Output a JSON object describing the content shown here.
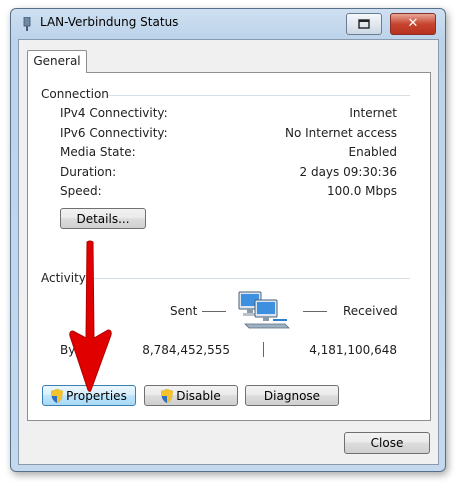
{
  "window": {
    "title": "LAN-Verbindung Status"
  },
  "tabs": [
    {
      "label": "General",
      "active": true
    }
  ],
  "connection": {
    "label": "Connection",
    "rows": [
      {
        "label": "IPv4 Connectivity:",
        "value": "Internet"
      },
      {
        "label": "IPv6 Connectivity:",
        "value": "No Internet access"
      },
      {
        "label": "Media State:",
        "value": "Enabled"
      },
      {
        "label": "Duration:",
        "value": "2 days 09:30:36"
      },
      {
        "label": "Speed:",
        "value": "100.0 Mbps"
      }
    ],
    "details_button": "Details..."
  },
  "activity": {
    "label": "Activity",
    "sent_label": "Sent",
    "received_label": "Received",
    "bytes_label": "Bytes:",
    "bytes_sent": "8,784,452,555",
    "bytes_received": "4,181,100,648"
  },
  "buttons": {
    "properties": "Properties",
    "disable": "Disable",
    "diagnose": "Diagnose",
    "close": "Close"
  },
  "icons": {
    "network": "network-computers-icon",
    "shield": "uac-shield-icon",
    "annotation": "red-arrow-icon"
  },
  "colors": {
    "annotation_arrow": "#e00000",
    "focus_border": "#3c7fb1"
  }
}
